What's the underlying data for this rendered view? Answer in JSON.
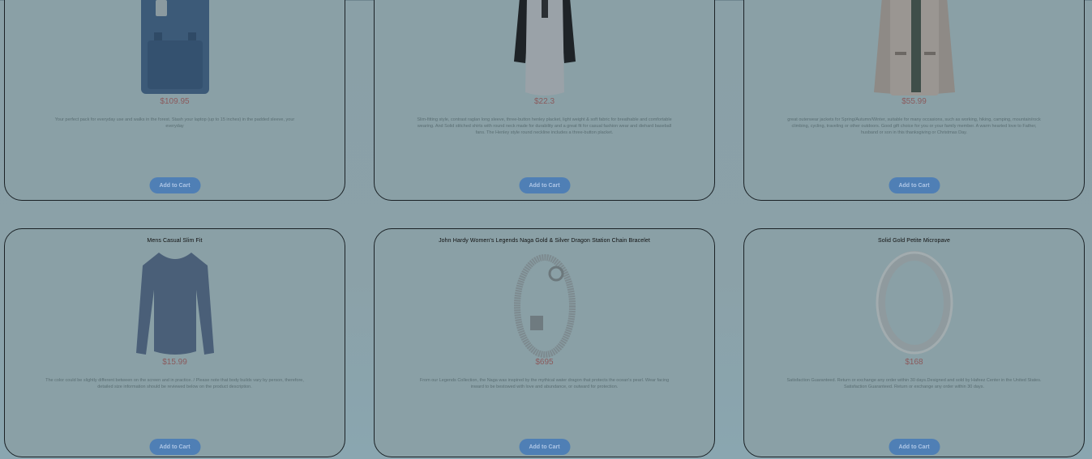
{
  "products": [
    {
      "title": "",
      "price": "$109.95",
      "description": "Your perfect pack for everyday use and walks in the forest. Stash your laptop (up to 15 inches) in the padded sleeve, your everyday",
      "button_label": "Add to Cart",
      "icon": "backpack-image"
    },
    {
      "title": "",
      "price": "$22.3",
      "description": "Slim-fitting style, contrast raglan long sleeve, three-button henley placket, light weight & soft fabric for breathable and comfortable wearing. And Solid stitched shirts with round neck made for durability and a great fit for casual fashion wear and diehard baseball fans. The Henley style round neckline includes a three-button placket.",
      "button_label": "Add to Cart",
      "icon": "henley-shirt-image"
    },
    {
      "title": "",
      "price": "$55.99",
      "description": "great outerwear jackets for Spring/Autumn/Winter, suitable for many occasions, such as working, hiking, camping, mountain/rock climbing, cycling, traveling or other outdoors. Good gift choice for you or your family member. A warm hearted love to Father, husband or son in this thanksgiving or Christmas Day.",
      "button_label": "Add to Cart",
      "icon": "jacket-image"
    },
    {
      "title": "Mens Casual Slim Fit",
      "price": "$15.99",
      "description": "The color could be slightly different between on the screen and in practice. / Please note that body builds vary by person, therefore, detailed size information should be reviewed below on the product description.",
      "button_label": "Add to Cart",
      "icon": "long-sleeve-shirt-image"
    },
    {
      "title": "John Hardy Women's Legends Naga Gold & Silver Dragon Station Chain Bracelet",
      "price": "$695",
      "description": "From our Legends Collection, the Naga was inspired by the mythical water dragon that protects the ocean's pearl. Wear facing inward to be bestowed with love and abundance, or outward for protection.",
      "button_label": "Add to Cart",
      "icon": "bracelet-image"
    },
    {
      "title": "Solid Gold Petite Micropave",
      "price": "$168",
      "description": "Satisfaction Guaranteed. Return or exchange any order within 30 days.Designed and sold by Hafeez Center in the United States. Satisfaction Guaranteed. Return or exchange any order within 30 days.",
      "button_label": "Add to Cart",
      "icon": "ring-image"
    }
  ]
}
